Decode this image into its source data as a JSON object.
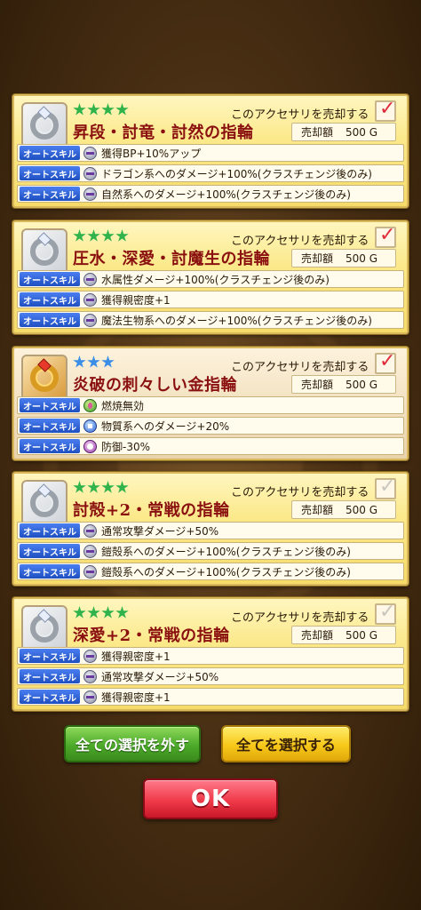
{
  "cards": [
    {
      "stars": 4,
      "star_color": "#2fb34a",
      "icon": "silver-ring-icon",
      "sell_label": "このアクセサリを売却する",
      "checked": true,
      "name": "昇段・討竜・討然の指輪",
      "price_label": "売却額",
      "price_value": "500 G",
      "skills": [
        {
          "tag": "オートスキル",
          "icon": "skill-icon",
          "text": "獲得BP+10%アップ"
        },
        {
          "tag": "オートスキル",
          "icon": "skill-icon",
          "text": "ドラゴン系へのダメージ+100%(クラスチェンジ後のみ)"
        },
        {
          "tag": "オートスキル",
          "icon": "skill-icon",
          "text": "自然系へのダメージ+100%(クラスチェンジ後のみ)"
        }
      ]
    },
    {
      "stars": 4,
      "star_color": "#2fb34a",
      "icon": "silver-ring-icon",
      "sell_label": "このアクセサリを売却する",
      "checked": true,
      "name": "圧水・深愛・討魔生の指輪",
      "price_label": "売却額",
      "price_value": "500 G",
      "skills": [
        {
          "tag": "オートスキル",
          "icon": "skill-icon",
          "text": "水属性ダメージ+100%(クラスチェンジ後のみ)"
        },
        {
          "tag": "オートスキル",
          "icon": "skill-icon",
          "text": "獲得親密度+1"
        },
        {
          "tag": "オートスキル",
          "icon": "skill-icon",
          "text": "魔法生物系へのダメージ+100%(クラスチェンジ後のみ)"
        }
      ]
    },
    {
      "stars": 3,
      "star_color": "#3a8ee8",
      "icon": "gold-ring-icon",
      "sell_label": "このアクセサリを売却する",
      "checked": true,
      "name": "炎破の刺々しい金指輪",
      "price_label": "売却額",
      "price_value": "500 G",
      "skills": [
        {
          "tag": "オートスキル",
          "icon": "fire-skill-icon",
          "text": "燃焼無効"
        },
        {
          "tag": "オートスキル",
          "icon": "physical-skill-icon",
          "text": "物質系へのダメージ+20%"
        },
        {
          "tag": "オートスキル",
          "icon": "defense-skill-icon",
          "text": "防御-30%"
        }
      ]
    },
    {
      "stars": 4,
      "star_color": "#2fb34a",
      "icon": "silver-ring-icon",
      "sell_label": "このアクセサリを売却する",
      "checked": false,
      "name": "討殻+2・常戦の指輪",
      "price_label": "売却額",
      "price_value": "500 G",
      "skills": [
        {
          "tag": "オートスキル",
          "icon": "skill-icon",
          "text": "通常攻撃ダメージ+50%"
        },
        {
          "tag": "オートスキル",
          "icon": "skill-icon",
          "text": "鎧殻系へのダメージ+100%(クラスチェンジ後のみ)"
        },
        {
          "tag": "オートスキル",
          "icon": "skill-icon",
          "text": "鎧殻系へのダメージ+100%(クラスチェンジ後のみ)"
        }
      ]
    },
    {
      "stars": 4,
      "star_color": "#2fb34a",
      "icon": "silver-ring-icon",
      "sell_label": "このアクセサリを売却する",
      "checked": false,
      "name": "深愛+2・常戦の指輪",
      "price_label": "売却額",
      "price_value": "500 G",
      "skills": [
        {
          "tag": "オートスキル",
          "icon": "skill-icon",
          "text": "獲得親密度+1"
        },
        {
          "tag": "オートスキル",
          "icon": "skill-icon",
          "text": "通常攻撃ダメージ+50%"
        },
        {
          "tag": "オートスキル",
          "icon": "skill-icon",
          "text": "獲得親密度+1"
        }
      ]
    }
  ],
  "buttons": {
    "clear_all": "全ての選択を外す",
    "select_all": "全てを選択する",
    "ok": "OK"
  },
  "colors": {
    "checked_mark": "#e02a3a",
    "unchecked_mark": "#c9c6bd",
    "title_red": "#8a1010",
    "skill_tag_blue": "#1f4fc0"
  },
  "check_glyph": "✓"
}
